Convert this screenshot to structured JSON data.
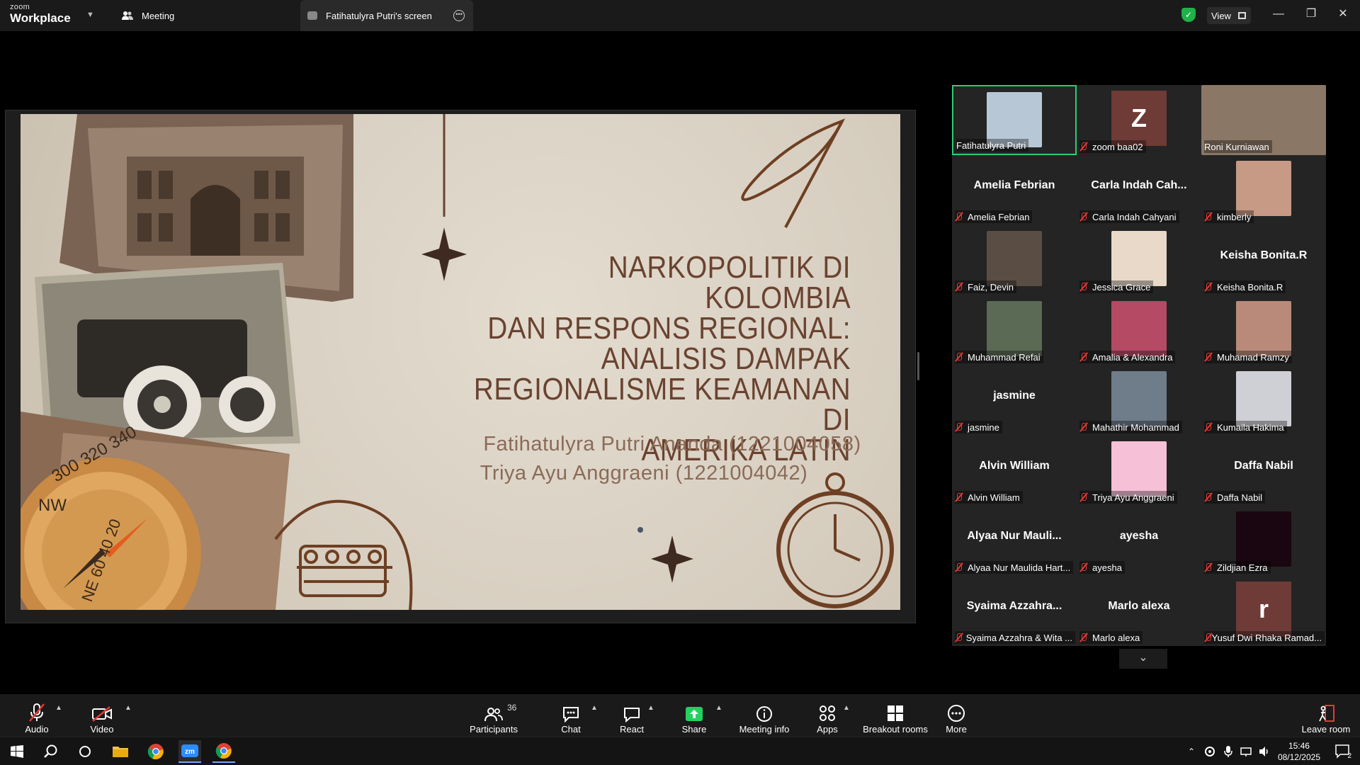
{
  "app": {
    "logo_line1": "zoom",
    "logo_line2": "Workplace",
    "tabs": [
      {
        "label": "Meeting"
      },
      {
        "label": "Fatihatulyra Putri's screen"
      }
    ],
    "view_label": "View",
    "accent_green": "#2ecc71",
    "mute_red": "#e53935"
  },
  "slide": {
    "title_lines": [
      "NARKOPOLITIK DI KOLOMBIA",
      "DAN RESPONS REGIONAL:",
      "ANALISIS DAMPAK",
      "REGIONALISME KEAMANAN DI",
      "AMERIKA LATIN"
    ],
    "author_1": "Fatihatulyra Putri Ananda (1221004058)",
    "author_2": "Triya Ayu Anggraeni (1221004042)"
  },
  "gallery": {
    "participants": [
      {
        "label": "Fatihatulyra Putri",
        "display": "photo",
        "muted": false
      },
      {
        "label": "zoom baa02",
        "display": "initial",
        "initial": "Z",
        "muted": true
      },
      {
        "label": "Roni Kurniawan",
        "display": "photo",
        "muted": false
      },
      {
        "label": "Amelia Febrian",
        "display": "name",
        "name": "Amelia Febrian",
        "muted": true
      },
      {
        "label": "Carla Indah Cahyani",
        "display": "name",
        "name": "Carla Indah Cah...",
        "muted": true
      },
      {
        "label": "kimberly",
        "display": "photo",
        "muted": true
      },
      {
        "label": "Faiz, Devin",
        "display": "photo",
        "muted": true
      },
      {
        "label": "Jessica Grace",
        "display": "photo",
        "muted": true
      },
      {
        "label": "Keisha Bonita.R",
        "display": "name",
        "name": "Keisha Bonita.R",
        "muted": true
      },
      {
        "label": "Muhammad Refai",
        "display": "photo",
        "muted": true
      },
      {
        "label": "Amalia & Alexandra",
        "display": "photo",
        "muted": true
      },
      {
        "label": "Muhamad Ramzy",
        "display": "photo",
        "muted": true
      },
      {
        "label": "jasmine",
        "display": "name",
        "name": "jasmine",
        "muted": true
      },
      {
        "label": "Mahathir Mohammad",
        "display": "photo",
        "muted": true
      },
      {
        "label": "Kumaila Hakima",
        "display": "photo",
        "muted": true
      },
      {
        "label": "Alvin William",
        "display": "name",
        "name": "Alvin William",
        "muted": true
      },
      {
        "label": "Triya Ayu Anggraeni",
        "display": "photo",
        "muted": true
      },
      {
        "label": "Daffa Nabil",
        "display": "name",
        "name": "Daffa Nabil",
        "muted": true
      },
      {
        "label": "Alyaa Nur Maulida Hart...",
        "display": "name",
        "name": "Alyaa Nur Mauli...",
        "muted": true
      },
      {
        "label": "ayesha",
        "display": "name",
        "name": "ayesha",
        "muted": true
      },
      {
        "label": "Zildjian Ezra",
        "display": "photo",
        "muted": true
      },
      {
        "label": "Syaima Azzahra & Wita ...",
        "display": "name",
        "name": "Syaima Azzahra...",
        "muted": true
      },
      {
        "label": "Marlo alexa",
        "display": "name",
        "name": "Marlo alexa",
        "muted": true
      },
      {
        "label": "Yusuf Dwi Rhaka Ramad...",
        "display": "initial",
        "initial": "r",
        "muted": true
      }
    ]
  },
  "toolbar": {
    "audio": "Audio",
    "video": "Video",
    "participants": "Participants",
    "participants_count": "36",
    "chat": "Chat",
    "react": "React",
    "share": "Share",
    "meeting_info": "Meeting info",
    "apps": "Apps",
    "breakout_rooms": "Breakout rooms",
    "more": "More",
    "leave_room": "Leave room"
  },
  "taskbar": {
    "time": "15:46",
    "date": "08/12/2025",
    "notification_count": "2"
  }
}
